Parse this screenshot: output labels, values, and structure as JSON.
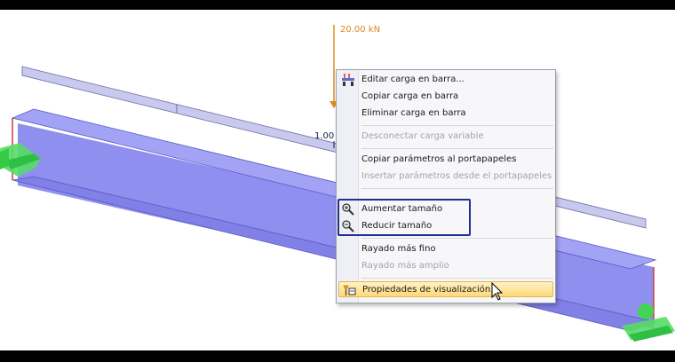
{
  "scene": {
    "load_value_label": "20.00 kN",
    "beam_label": "1.00"
  },
  "context_menu": {
    "items": [
      {
        "label": "Editar carga en barra...",
        "enabled": true,
        "icon": "edit-load-icon"
      },
      {
        "label": "Copiar carga en barra",
        "enabled": true
      },
      {
        "label": "Eliminar carga en barra",
        "enabled": true
      },
      {
        "label": "Desconectar carga variable",
        "enabled": false
      },
      {
        "label": "Copiar parámetros al portapapeles",
        "enabled": true
      },
      {
        "label": "Insertar parámetros desde el portapapeles",
        "enabled": false
      },
      {
        "label": "Aumentar tamaño",
        "enabled": true,
        "icon": "zoom-in-icon"
      },
      {
        "label": "Reducir tamaño",
        "enabled": true,
        "icon": "zoom-out-icon"
      },
      {
        "label": "Rayado más fino",
        "enabled": true
      },
      {
        "label": "Rayado más amplio",
        "enabled": false
      },
      {
        "label": "Propiedades de visualización...",
        "enabled": true,
        "icon": "display-properties-icon",
        "highlighted": true
      }
    ]
  },
  "colors": {
    "beam": "#8f8ff0",
    "load_arrow": "#e08a1e",
    "support": "#44dd55",
    "highlight_frame": "#1e2e96",
    "menu_hover": "#ffd978"
  }
}
